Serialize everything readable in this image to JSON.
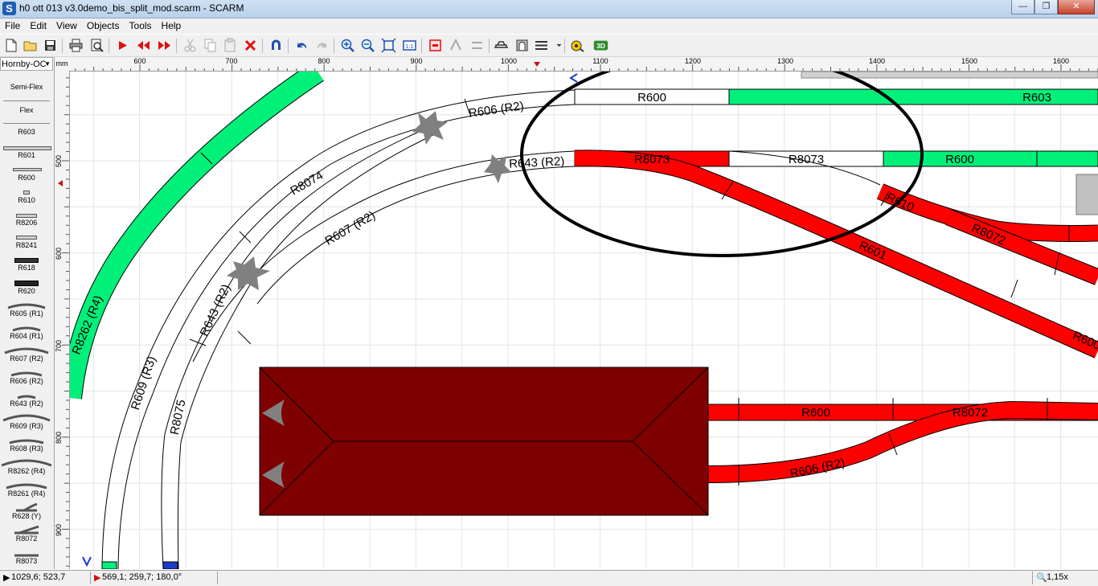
{
  "window": {
    "title": "h0 ott 013 v3.0demo_bis_split_mod.scarm - SCARM",
    "app_icon": "S",
    "min": "—",
    "max": "❐",
    "close": "✕"
  },
  "menu": [
    "File",
    "Edit",
    "View",
    "Objects",
    "Tools",
    "Help"
  ],
  "library": {
    "selected": "Hornby-OC",
    "items": [
      "Semi-Flex",
      "Flex",
      "R603",
      "R601",
      "R600",
      "R610",
      "R8206",
      "R8241",
      "R618",
      "R620",
      "R605 (R1)",
      "R604 (R1)",
      "R607 (R2)",
      "R606 (R2)",
      "R643 (R2)",
      "R609 (R3)",
      "R608 (R3)",
      "R8262 (R4)",
      "R8261 (R4)",
      "R628 (Y)",
      "R8072",
      "R8073"
    ]
  },
  "ruler": {
    "units": "mm",
    "top": [
      "600",
      "700",
      "800",
      "900",
      "1000",
      "1100",
      "1200",
      "1300",
      "1400",
      "1500",
      "1600"
    ],
    "left": [
      "500",
      "600",
      "700",
      "800",
      "900"
    ]
  },
  "tracks": {
    "r600_top": "R600",
    "r603_top": "R603",
    "r606": "R606 (R2)",
    "r643_top": "R643 (R2)",
    "r8073_red": "R8073",
    "r8073_white": "R8073",
    "r600_mid": "R600",
    "r610": "R610",
    "r8072_right": "R8072",
    "r601": "R601",
    "r600_right_cut": "R600",
    "r8074": "R8074",
    "r607": "R607 (R2)",
    "r643_left": "R643 (R2)",
    "r609": "R609 (R3)",
    "r8075": "R8075",
    "r8262": "R8262 (R4)",
    "r600_bottom": "R600",
    "r8072_bottom": "R8072",
    "r606_bottom": "R606 (R2)"
  },
  "colors": {
    "green_track": "#00f07a",
    "red_track": "#ff0000",
    "building": "#7f0000",
    "buffer_gray": "#808080",
    "highlight_blue": "#1a3cc8"
  },
  "status": {
    "cursor": "1029,6; 523,7",
    "object": "569,1; 259,7; 180,0°",
    "zoom": "1,15x"
  }
}
